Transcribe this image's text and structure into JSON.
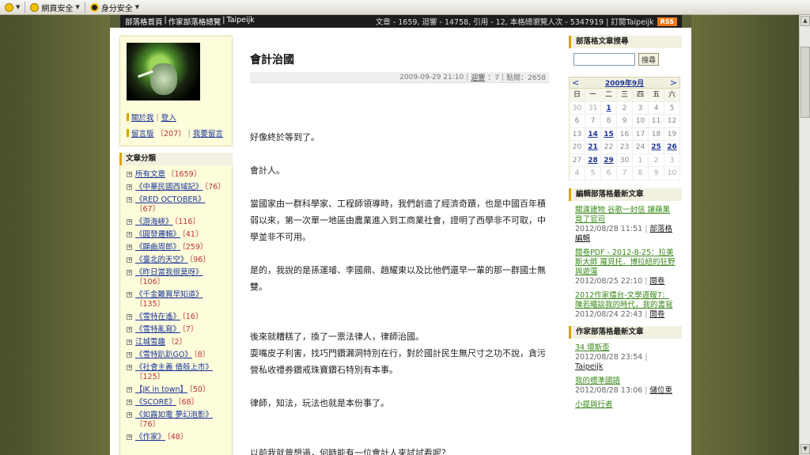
{
  "toolbar": {
    "items": [
      {
        "label": ""
      },
      {
        "label": "網頁安全"
      },
      {
        "label": "身分安全"
      }
    ]
  },
  "blog_bar": {
    "crumbs": [
      "部落格首頁",
      "作家部落格總覽",
      "Taipeijk"
    ],
    "stats": "文章 - 1659, 迴響 - 14758, 引用 - 12, 本格總瀏覽人次 - 5347919 | 訂閱Taipeijk",
    "rss": "RSS"
  },
  "left": {
    "links": [
      {
        "a": "關於我",
        "b": "登入"
      },
      {
        "a": "留言版",
        "count": "〔207〕",
        "b": "我要留言"
      }
    ],
    "categories_title": "文章分類",
    "categories": [
      {
        "name": "所有文章",
        "count": "〔1659〕"
      },
      {
        "name": "《中華民國西域記》",
        "count": "〔76〕"
      },
      {
        "name": "《RED OCTOBER》",
        "count": "〔67〕"
      },
      {
        "name": "《游海峽》",
        "count": "〔116〕"
      },
      {
        "name": "《圓發邏輯》",
        "count": "〔41〕"
      },
      {
        "name": "《顯曲周郎》",
        "count": "〔259〕"
      },
      {
        "name": "《臺北的天空》",
        "count": "〔96〕"
      },
      {
        "name": "《昨日當我很莫呀》",
        "count": "〔106〕"
      },
      {
        "name": "《千金難買早知道》",
        "count": "〔135〕"
      },
      {
        "name": "《雪特在遙》",
        "count": "〔16〕"
      },
      {
        "name": "《雪特亂寫》",
        "count": "〔7〕"
      },
      {
        "name": "江城雪趣",
        "count": "〔2〕"
      },
      {
        "name": "《雪特趴趴GO》",
        "count": "〔8〕"
      },
      {
        "name": "《社會主義 借殼上市》",
        "count": "〔125〕"
      },
      {
        "name": "【JK in town】",
        "count": "〔50〕"
      },
      {
        "name": "《SCORE》",
        "count": "〔68〕"
      },
      {
        "name": "《如露如電 夢幻泡影》",
        "count": "〔76〕"
      },
      {
        "name": "《作家》",
        "count": "〔48〕"
      }
    ]
  },
  "post": {
    "title": "會計治國",
    "date": "2009-09-29 21:10",
    "replies_label": "迴響",
    "replies": "：7",
    "views": "點閱：2658",
    "paragraphs": [
      "好像終於等到了。",
      "會計人。",
      "當國家由一群科學家、工程師領導時，我們創造了經濟奇蹟，也是中國百年積弱以來，第一次單一地區由農業進入到工商業社會，證明了西學非不可取，中學並非不可用。",
      "是的，我說的是孫運璿、李國鼎、趙耀東以及比他們還早一輩的那一群國士無雙。",
      "後來就糟糕了，換了一票法律人，律師治國。",
      "耍嘴皮子利害，找巧門鑽漏洞特別在行，對於國計民生無尺寸之功不說，貪污營私收禮券鑽戒珠寶鑽石特別有本事。",
      "律師，知法，玩法也就是本份事了。",
      "以前我就曾想過，何時能有一位會計人來試試看呢？"
    ]
  },
  "right": {
    "search_title": "部落格文章搜尋",
    "search_button": "搜尋",
    "calendar": {
      "month": "2009年9月",
      "prev": "<",
      "next": ">",
      "weekdays": [
        "日",
        "一",
        "二",
        "三",
        "四",
        "五",
        "六"
      ],
      "days": [
        "30",
        "31",
        "1",
        "2",
        "3",
        "4",
        "5",
        "6",
        "7",
        "8",
        "9",
        "10",
        "11",
        "12",
        "13",
        "14",
        "15",
        "16",
        "17",
        "18",
        "19",
        "20",
        "21",
        "22",
        "23",
        "24",
        "25",
        "26",
        "27",
        "28",
        "29",
        "30",
        "1",
        "2",
        "3",
        "4",
        "5",
        "6",
        "7",
        "8",
        "9",
        "10"
      ]
    },
    "editor_title": "編輯部落格最新文章",
    "editor_entries": [
      {
        "title": "關渡建物 谷歌一封信 讓蘋果竟了官司",
        "date": "2012/08/28 11:51",
        "who": "部落格編輯"
      },
      {
        "title": "閱卷PDF - 2012-8-25：拉美斯大師 羅貝托．博拉紐的狂野與遊蕩",
        "date": "2012/08/25 22:10",
        "who": "閱卷"
      },
      {
        "title": "2012作家擂台-文學週報7：陳若曦談我的時代，我的書寫",
        "date": "2012/08/24 22:43",
        "who": "閱卷"
      }
    ],
    "writer_title": "作家部落格最新文章",
    "writer_entries": [
      {
        "title": "34 壞斯歪",
        "date": "2012/08/28 23:54",
        "who": "Taipeijk"
      },
      {
        "title": "我的標準國語",
        "date": "2012/08/28 13:06",
        "who": "儲位東"
      },
      {
        "title": "小提與行者",
        "date": "",
        "who": ""
      }
    ]
  }
}
